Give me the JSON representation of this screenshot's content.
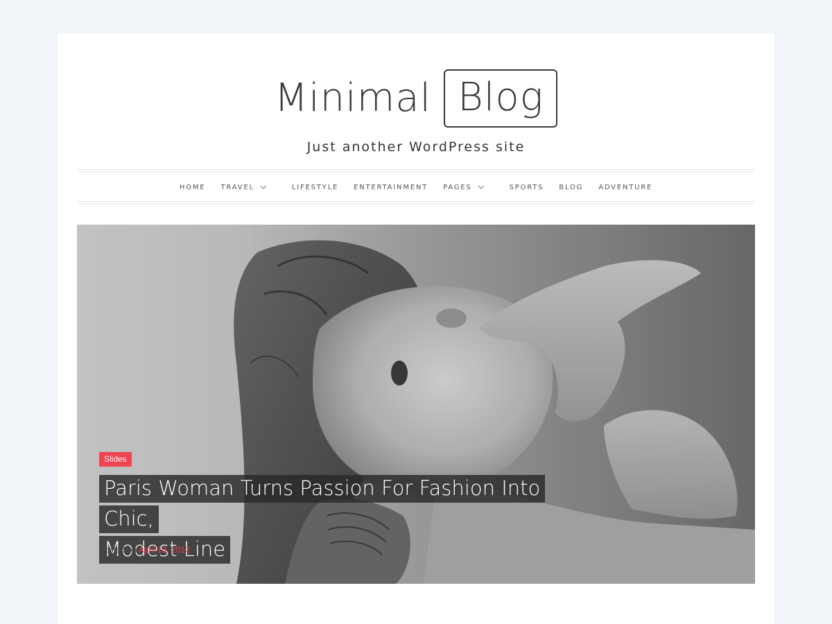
{
  "site": {
    "title_part1": "Minimal",
    "title_part2": "Blog",
    "tagline": "Just another WordPress site"
  },
  "nav": {
    "items": [
      {
        "label": "HOME",
        "has_dropdown": false
      },
      {
        "label": "TRAVEL",
        "has_dropdown": true
      },
      {
        "label": "LIFESTYLE",
        "has_dropdown": false
      },
      {
        "label": "ENTERTAINMENT",
        "has_dropdown": false
      },
      {
        "label": "PAGES",
        "has_dropdown": true
      },
      {
        "label": "SPORTS",
        "has_dropdown": false
      },
      {
        "label": "BLOG",
        "has_dropdown": false
      },
      {
        "label": "ADVENTURE",
        "has_dropdown": false
      }
    ],
    "dropdown_icon": "chevron-down-icon"
  },
  "featured": {
    "category": "Slides",
    "title_line1": "Paris Woman Turns Passion For Fashion Into Chic,",
    "title_line2": "Modest Line",
    "posted_prefix": "Posted on",
    "posted_date": "April 18, 2012"
  },
  "colors": {
    "accent": "#ef4352",
    "page_background": "#f1f5fa",
    "content_background": "#ffffff",
    "title_text": "#3a3a3a"
  }
}
